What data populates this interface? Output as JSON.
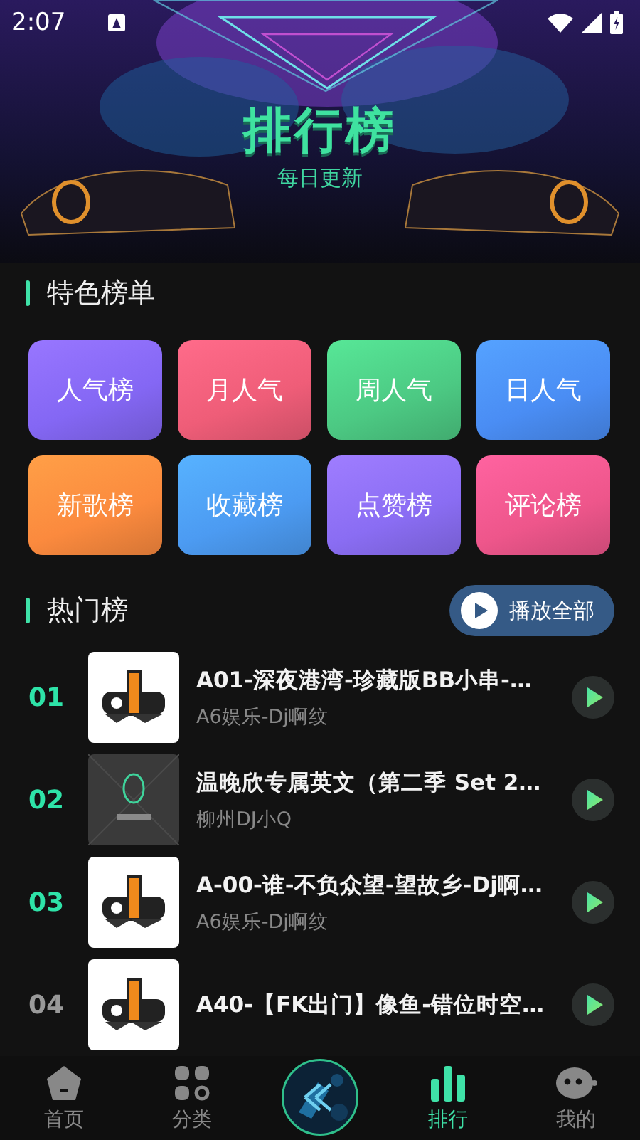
{
  "status_bar": {
    "time": "2:07"
  },
  "banner": {
    "title": "排行榜",
    "subtitle": "每日更新"
  },
  "featured": {
    "heading": "特色榜单",
    "items": [
      {
        "label": "人气榜",
        "color": "#8467f4"
      },
      {
        "label": "月人气",
        "color": "#ef5d78"
      },
      {
        "label": "周人气",
        "color": "#4cc983"
      },
      {
        "label": "日人气",
        "color": "#4a8df4"
      },
      {
        "label": "新歌榜",
        "color": "#fb8a3e"
      },
      {
        "label": "收藏榜",
        "color": "#4c9bf2"
      },
      {
        "label": "点赞榜",
        "color": "#8a6df3"
      },
      {
        "label": "评论榜",
        "color": "#ee568b"
      }
    ]
  },
  "hot": {
    "heading": "热门榜",
    "play_all": "播放全部",
    "rows": [
      {
        "rank": "01",
        "title": "A01-深夜港湾-珍藏版BB小串-…",
        "artist": "A6娱乐-Dj啊纹"
      },
      {
        "rank": "02",
        "title": "温晚欣专属英文（第二季 Set 2…",
        "artist": "柳州DJ小Q"
      },
      {
        "rank": "03",
        "title": "A-00-谁-不负众望-望故乡-Dj啊…",
        "artist": "A6娱乐-Dj啊纹"
      },
      {
        "rank": "04",
        "title": "A40-【FK出门】像鱼-错位时空…"
      }
    ]
  },
  "tabs": [
    {
      "label": "首页",
      "selected": false,
      "kind": "home"
    },
    {
      "label": "分类",
      "selected": false,
      "kind": "grid"
    },
    {
      "label": "排行",
      "selected": true,
      "kind": "chart"
    },
    {
      "label": "我的",
      "selected": false,
      "kind": "face"
    }
  ]
}
